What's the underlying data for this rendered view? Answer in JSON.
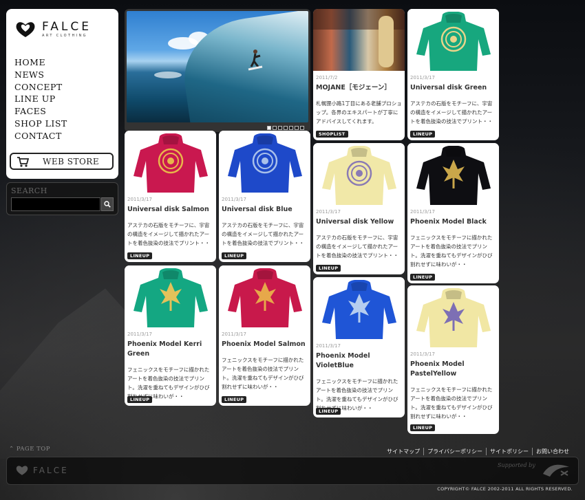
{
  "brand": {
    "name": "FALCE",
    "subtitle": "ART CLOTHING"
  },
  "nav": [
    "HOME",
    "NEWS",
    "CONCEPT",
    "LINE UP",
    "FACES",
    "SHOP LIST",
    "CONTACT"
  ],
  "webstore_label": "WEB STORE",
  "search": {
    "label": "SEARCH",
    "placeholder": ""
  },
  "slider": {
    "dots": 7,
    "active": 0
  },
  "cards": [
    {
      "date": "2011/7/2",
      "title": "MOJANE［モジェーン］",
      "desc": "札幌狸小路1丁目にある老舗プロショップ。各界のエキスパートが丁寧にアドバイスしてくれます。",
      "tag": "SHOPLIST",
      "color": "#b98a4a",
      "kind": "shop"
    },
    {
      "date": "2011/3/17",
      "title": "Universal disk Green",
      "desc": "アステカの石版をモチーフに、宇宙の構造をイメージして描かれたアートを着色抜染の技法でプリント・・",
      "tag": "LINEUP",
      "color": "#17a77e",
      "print": "#e9d48a",
      "kind": "disk"
    },
    {
      "date": "2011/3/17",
      "title": "Universal disk Salmon",
      "desc": "アステカの石版をモチーフに、宇宙の構造をイメージして描かれたアートを着色抜染の技法でプリント・・",
      "tag": "LINEUP",
      "color": "#c9184f",
      "print": "#e8b64a",
      "kind": "disk"
    },
    {
      "date": "2011/3/17",
      "title": "Universal disk Blue",
      "desc": "アステカの石版をモチーフに、宇宙の構造をイメージして描かれたアートを着色抜染の技法でプリント・・",
      "tag": "LINEUP",
      "color": "#1e49c9",
      "print": "#a9c0ea",
      "kind": "disk"
    },
    {
      "date": "2011/3/17",
      "title": "Universal disk Yellow",
      "desc": "アステカの石版をモチーフに、宇宙の構造をイメージして描かれたアートを着色抜染の技法でプリント・・",
      "tag": "LINEUP",
      "color": "#f1e8a8",
      "print": "#8a7ab4",
      "kind": "disk"
    },
    {
      "date": "2011/3/17",
      "title": "Phoenix Model Black",
      "desc": "フェニックスをモチーフに描かれたアートを着色抜染の技法でプリント。洗濯を重ねてもデザインがひび割れせずに味わいが・・",
      "tag": "LINEUP",
      "color": "#0e0e12",
      "print": "#c9a64a",
      "kind": "phoenix"
    },
    {
      "date": "2011/3/17",
      "title": "Phoenix Model Kerri Green",
      "desc": "フェニックスをモチーフに描かれたアートを着色抜染の技法でプリント。洗濯を重ねてもデザインがひび割れせずに味わいが・・",
      "tag": "LINEUP",
      "color": "#14a782",
      "print": "#e3c25a",
      "kind": "phoenix"
    },
    {
      "date": "2011/3/17",
      "title": "Phoenix Model Salmon",
      "desc": "フェニックスをモチーフに描かれたアートを着色抜染の技法でプリント。洗濯を重ねてもデザインがひび割れせずに味わいが・・",
      "tag": "LINEUP",
      "color": "#c8194b",
      "print": "#e7a84a",
      "kind": "phoenix"
    },
    {
      "date": "2011/3/17",
      "title": "Phoenix Model VioletBlue",
      "desc": "フェニックスをモチーフに描かれたアートを着色抜染の技法でプリント。洗濯を重ねてもデザインがひび割れせずに味わいが・・",
      "tag": "LINEUP",
      "color": "#1f55d6",
      "print": "#b6cdef",
      "kind": "phoenix"
    },
    {
      "date": "2011/3/17",
      "title": "Phoenix Model PastelYellow",
      "desc": "フェニックスをモチーフに描かれたアートを着色抜染の技法でプリント。洗濯を重ねてもデザインがひび割れせずに味わいが・・",
      "tag": "LINEUP",
      "color": "#f1e7a4",
      "print": "#7d6fb4",
      "kind": "phoenix"
    }
  ],
  "footer": {
    "page_top": "PAGE TOP",
    "links": [
      "サイトマップ",
      "プライバシーポリシー",
      "サイトポリシー",
      "お問い合わせ"
    ],
    "logo": "FALCE",
    "supported_by": "Supported by",
    "copyright": "COPYRIGHT© FALCE 2002-2011 ALL RIGHTS RESERVED."
  }
}
